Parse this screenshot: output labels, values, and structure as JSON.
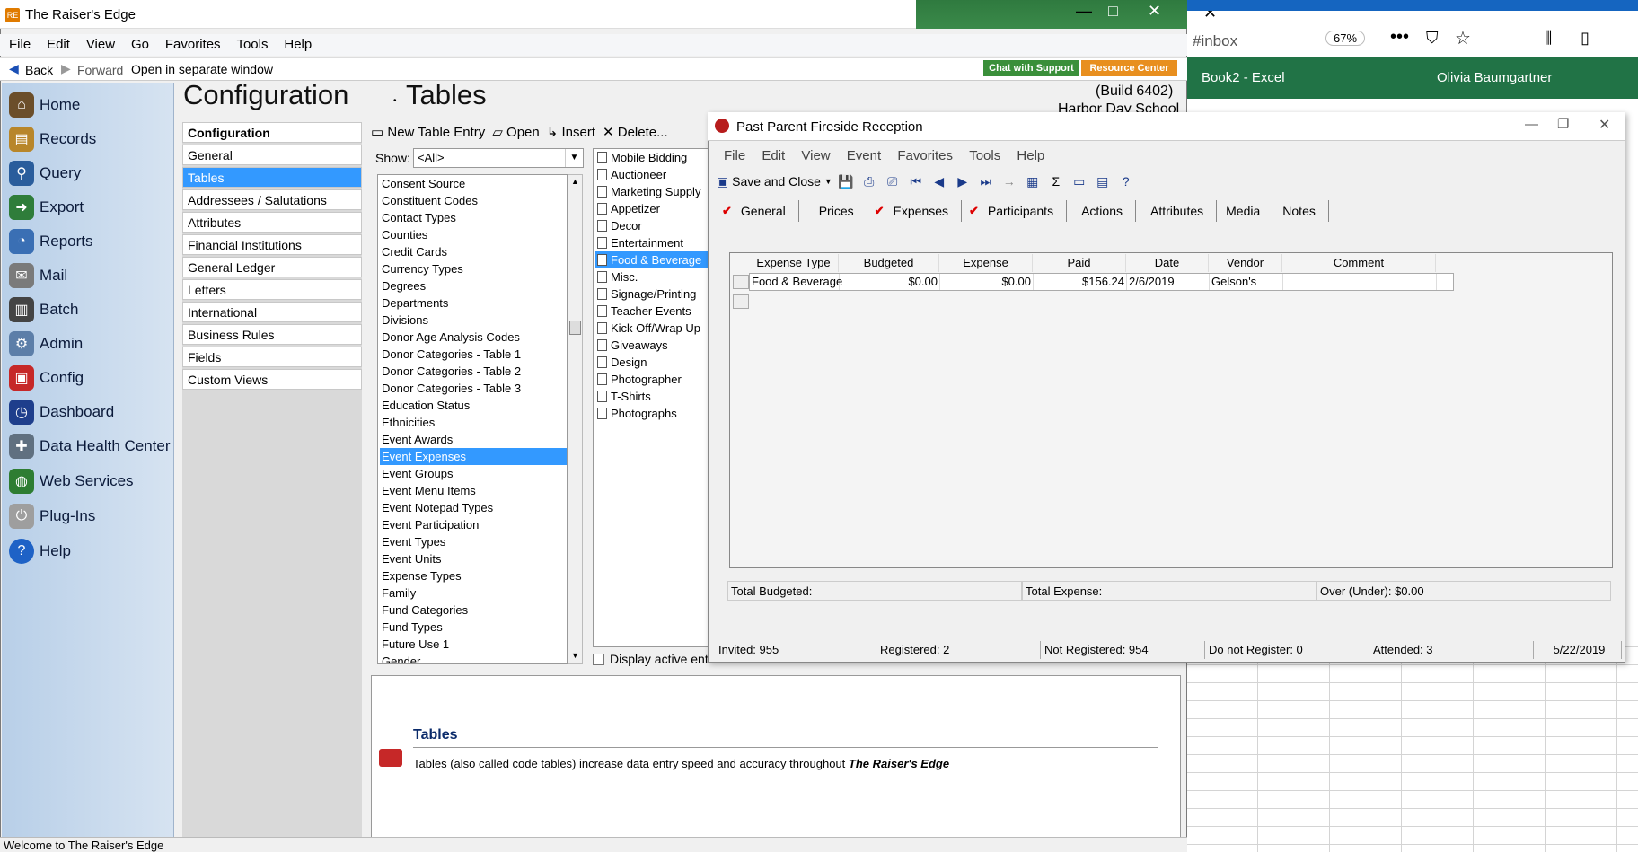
{
  "app": {
    "title": "The Raiser's Edge",
    "menu": [
      "File",
      "Edit",
      "View",
      "Go",
      "Favorites",
      "Tools",
      "Help"
    ],
    "nav": {
      "back": "Back",
      "forward": "Forward",
      "open_separate": "Open in separate window"
    },
    "chat_support": "Chat with Support",
    "resource_center": "Resource Center",
    "build": "(Build 6402)",
    "school": "Harbor Day School",
    "status": "Welcome to The Raiser's Edge"
  },
  "background": {
    "browser_url": "#inbox",
    "zoom": "67%",
    "excel_title": "Book2  -  Excel",
    "excel_user": "Olivia Baumgartner"
  },
  "sidebar": {
    "items": [
      {
        "label": "Home",
        "icon": "home-icon",
        "color": "#6b4e2a"
      },
      {
        "label": "Records",
        "icon": "records-icon",
        "color": "#b8862a"
      },
      {
        "label": "Query",
        "icon": "query-icon",
        "color": "#2a5d9c"
      },
      {
        "label": "Export",
        "icon": "export-icon",
        "color": "#2f7d3a"
      },
      {
        "label": "Reports",
        "icon": "reports-icon",
        "color": "#3a6fb4"
      },
      {
        "label": "Mail",
        "icon": "mail-icon",
        "color": "#7a7a7a"
      },
      {
        "label": "Batch",
        "icon": "batch-icon",
        "color": "#444444"
      },
      {
        "label": "Admin",
        "icon": "admin-icon",
        "color": "#5c7ea8"
      },
      {
        "label": "Config",
        "icon": "config-icon",
        "color": "#c62828"
      },
      {
        "label": "Dashboard",
        "icon": "dashboard-icon",
        "color": "#1e3e8c"
      },
      {
        "label": "Data Health Center",
        "icon": "data-health-icon",
        "color": "#607080"
      },
      {
        "label": "Web Services",
        "icon": "web-services-icon",
        "color": "#2e7d32"
      },
      {
        "label": "Plug-Ins",
        "icon": "plugins-icon",
        "color": "#9e9e9e"
      },
      {
        "label": "Help",
        "icon": "help-icon",
        "color": "#1e62c6"
      }
    ]
  },
  "header": {
    "section": "Configuration",
    "page": "Tables"
  },
  "config_list": {
    "title": "Configuration",
    "items": [
      "General",
      "Tables",
      "Addressees / Salutations",
      "Attributes",
      "Financial Institutions",
      "General Ledger",
      "Letters",
      "International",
      "Business Rules",
      "Fields",
      "Custom Views"
    ],
    "selected": "Tables"
  },
  "toolbar": {
    "new": "New Table Entry",
    "open": "Open",
    "insert": "Insert",
    "delete": "Delete..."
  },
  "show": {
    "label": "Show:",
    "value": "<All>"
  },
  "tables": [
    "Consent Source",
    "Constituent Codes",
    "Contact Types",
    "Counties",
    "Credit Cards",
    "Currency Types",
    "Degrees",
    "Departments",
    "Divisions",
    "Donor Age Analysis Codes",
    "Donor Categories - Table 1",
    "Donor Categories - Table 2",
    "Donor Categories - Table 3",
    "Education Status",
    "Ethnicities",
    "Event Awards",
    "Event Expenses",
    "Event Groups",
    "Event Menu Items",
    "Event Notepad Types",
    "Event Participation",
    "Event Types",
    "Event Units",
    "Expense Types",
    "Family",
    "Fund Categories",
    "Fund Types",
    "Future Use 1",
    "Gender"
  ],
  "tables_selected": "Event Expenses",
  "entries": [
    "Mobile Bidding",
    "Auctioneer",
    "Marketing Supply",
    "Appetizer",
    "Decor",
    "Entertainment",
    "Food & Beverage",
    "Misc.",
    "Signage/Printing",
    "Teacher Events",
    "Kick Off/Wrap Up",
    "Giveaways",
    "Design",
    "Photographer",
    "T-Shirts",
    "Photographs"
  ],
  "entries_selected": "Food & Beverage",
  "display_active": "Display active ent",
  "help": {
    "title": "Tables",
    "text": "Tables (also called code tables) increase data entry speed and accuracy throughout ",
    "text_em": "The Raiser's Edge"
  },
  "dialog": {
    "title": "Past Parent Fireside Reception",
    "menu": [
      "File",
      "Edit",
      "View",
      "Event",
      "Favorites",
      "Tools",
      "Help"
    ],
    "save_close": "Save and Close",
    "tabs": [
      {
        "label": "General",
        "checked": true
      },
      {
        "label": "Prices",
        "checked": false
      },
      {
        "label": "Expenses",
        "checked": true
      },
      {
        "label": "Participants",
        "checked": true
      },
      {
        "label": "Actions",
        "checked": false
      },
      {
        "label": "Attributes",
        "checked": false
      },
      {
        "label": "Media",
        "checked": false
      },
      {
        "label": "Notes",
        "checked": false
      }
    ],
    "grid_headers": [
      "Expense Type",
      "Budgeted",
      "Expense",
      "Paid",
      "Date",
      "Vendor",
      "Comment"
    ],
    "grid_row": [
      "Food & Beverage",
      "$0.00",
      "$0.00",
      "$156.24",
      "2/6/2019",
      "Gelson's",
      ""
    ],
    "totals": {
      "budgeted": "Total Budgeted:",
      "expense": "Total Expense:",
      "over": "Over (Under): $0.00"
    },
    "status": {
      "invited": "Invited: 955",
      "registered": "Registered: 2",
      "not_registered": "Not Registered: 954",
      "do_not_register": "Do not Register: 0",
      "attended": "Attended: 3",
      "date": "5/22/2019"
    }
  }
}
